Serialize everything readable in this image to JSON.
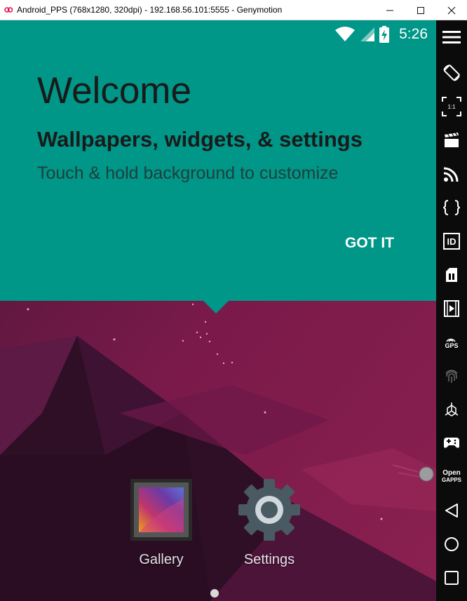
{
  "window": {
    "title": "Android_PPS (768x1280, 320dpi) - 192.168.56.101:5555 - Genymotion"
  },
  "statusbar": {
    "time": "5:26",
    "icons": [
      "wifi-icon",
      "cell-signal-icon",
      "battery-charging-icon"
    ]
  },
  "welcome": {
    "title": "Welcome",
    "subtitle": "Wallpapers, widgets, & settings",
    "description": "Touch & hold background to customize",
    "button_label": "GOT IT",
    "color": "#009688"
  },
  "home": {
    "apps": [
      {
        "label": "Gallery",
        "icon": "gallery-icon"
      },
      {
        "label": "Settings",
        "icon": "settings-gear-icon"
      }
    ],
    "pages": 1,
    "current_page": 1
  },
  "toolbar": {
    "items": [
      "menu-icon",
      "rotate-icon",
      "pixel-perfect-icon",
      "capture-icon",
      "cast-icon",
      "api-icon",
      "device-id-icon",
      "sim-icon",
      "media-icon",
      "gps-icon",
      "fingerprint-icon",
      "sensor-icon",
      "gamepad-icon",
      "opengapps-icon",
      "back-icon",
      "home-icon",
      "recents-icon"
    ],
    "labels": {
      "pixel_perfect": "1:1",
      "id": "ID",
      "gps": "GPS",
      "open_gapps_line1": "Open",
      "open_gapps_line2": "GAPPS"
    }
  }
}
